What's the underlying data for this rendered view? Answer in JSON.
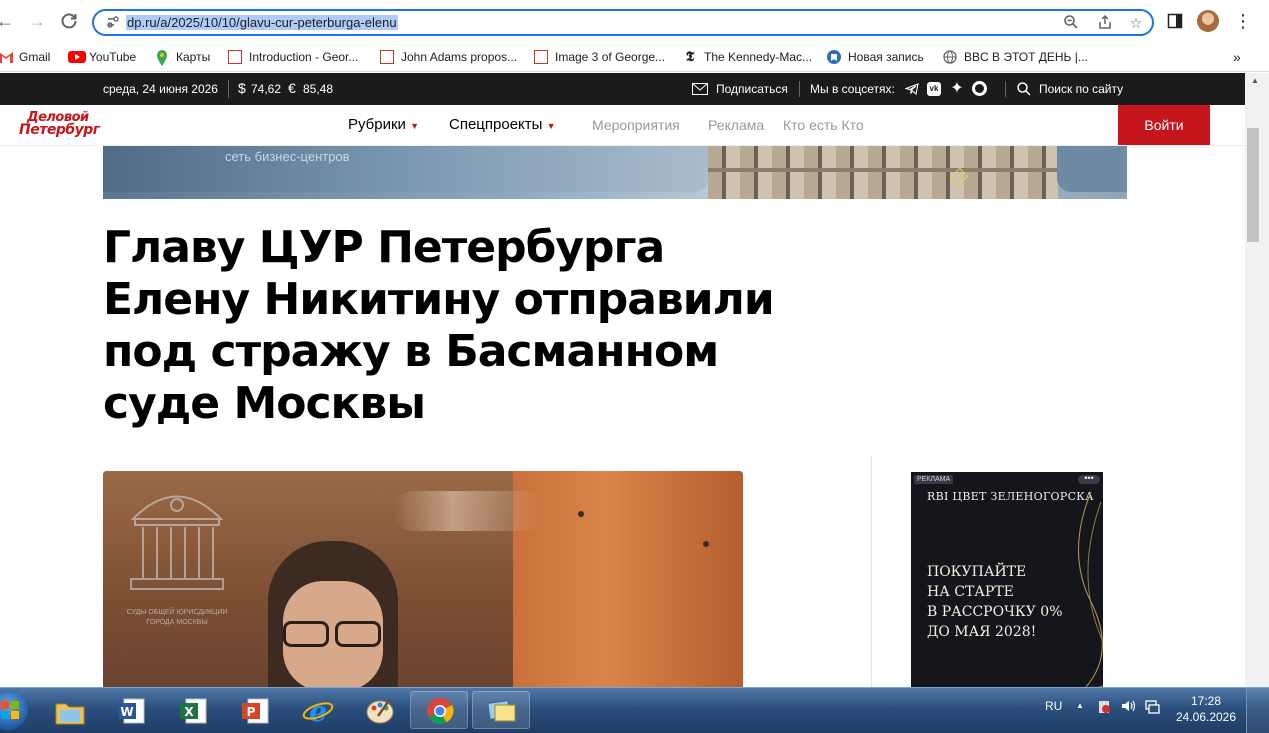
{
  "browser": {
    "url": "dp.ru/a/2025/10/10/glavu-cur-peterburga-elenu",
    "bookmarks": [
      {
        "label": "Gmail",
        "icon": "gmail-icon"
      },
      {
        "label": "YouTube",
        "icon": "youtube-icon"
      },
      {
        "label": "Карты",
        "icon": "maps-icon"
      },
      {
        "label": "Introduction - Geor...",
        "icon": "page-icon"
      },
      {
        "label": "John Adams propos...",
        "icon": "page-icon"
      },
      {
        "label": "Image 3 of George...",
        "icon": "page-icon"
      },
      {
        "label": "The Kennedy-Mac...",
        "icon": "nyt-icon"
      },
      {
        "label": "Новая запись",
        "icon": "bookmark-blue-icon"
      },
      {
        "label": "BBC В ЭТОТ ДЕНЬ |...",
        "icon": "globe-icon"
      }
    ],
    "more": "»"
  },
  "topbar": {
    "date": "среда, 24 июня 2026",
    "usd_symbol": "$",
    "usd": "74,62",
    "eur_symbol": "€",
    "eur": "85,48",
    "subscribe": "Подписаться",
    "social_label": "Мы в соцсетях:",
    "search": "Поиск по сайту"
  },
  "header": {
    "logo_line1": "Деловой",
    "logo_line2": "Петербург",
    "menu": [
      "Рубрики",
      "Спецпроекты",
      "Мероприятия",
      "Реклама",
      "Кто есть Кто"
    ],
    "login": "Войти"
  },
  "banner": {
    "text": "сеть бизнес-центров"
  },
  "article": {
    "headline": "Главу ЦУР Петербурга Елену Никитину отправили под стражу в Басманном суде Москвы",
    "photo_watermark": "СУДЫ ОБЩЕЙ ЮРИСДИКЦИИ ГОРОДА МОСКВЫ"
  },
  "ad": {
    "tag": "РЕКЛАМА",
    "brand_mark": "RBI",
    "brand": "ЦВЕТ ЗЕЛЕНОГОРСКА",
    "line1": "ПОКУПАЙТЕ",
    "line2": "НА СТАРТЕ",
    "line3": "В РАССРОЧКУ 0%",
    "line4": "ДО МАЯ 2028!"
  },
  "taskbar": {
    "lang": "RU",
    "time": "17:28",
    "date": "24.06.2026"
  },
  "colors": {
    "accent_blue": "#1a73e8",
    "site_red": "#c4161c",
    "topbar": "#1b1b1b"
  }
}
